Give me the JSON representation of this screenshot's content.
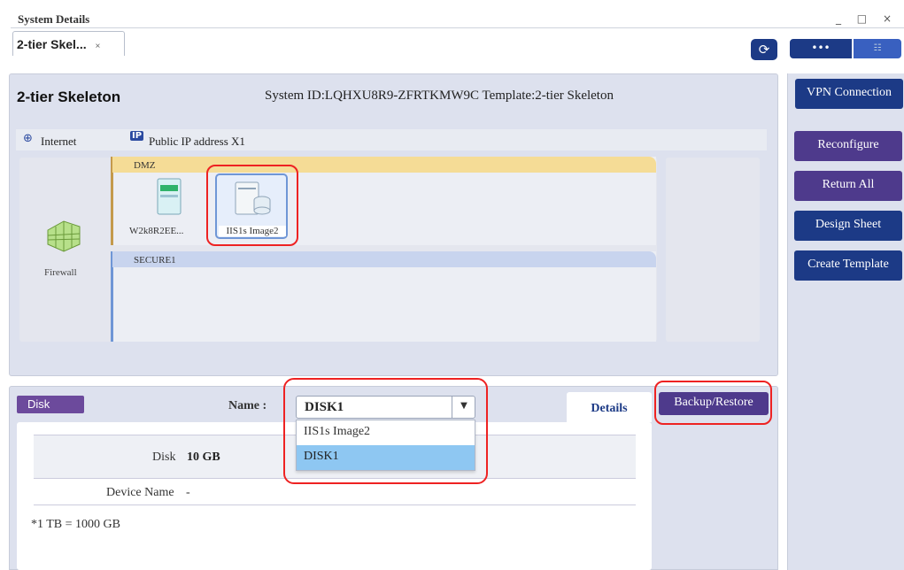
{
  "window": {
    "title": "System Details",
    "controls": {
      "minimize": "_",
      "maximize": "□",
      "close": "×"
    }
  },
  "tab": {
    "label": "2-tier Skel...",
    "close": "×"
  },
  "toolbar": {
    "refresh_icon": "⟳",
    "view_toggle": {
      "list_glyph": "•••",
      "grid_glyph": "☷"
    }
  },
  "system": {
    "name": "2-tier Skeleton",
    "info": "System ID:LQHXU8R9-ZFRTKMW9C  Template:2-tier Skeleton"
  },
  "network": {
    "internet_icon": "⊕",
    "internet_label": "Internet",
    "public_ip_icon": "IP",
    "public_ip_label": "Public IP address X1"
  },
  "diagram": {
    "firewall_label": "Firewall",
    "zones": [
      {
        "label": "DMZ",
        "color": "#f5dc96"
      },
      {
        "label": "SECURE1",
        "color": "#c8d4ee"
      }
    ],
    "servers": [
      {
        "label": "W2k8R2EE..."
      },
      {
        "label": "IIS1s Image2",
        "selected": true
      }
    ]
  },
  "side_buttons": {
    "vpn": "VPN Connection",
    "reconfigure": "Reconfigure",
    "return_all": "Return All",
    "design_sheet": "Design Sheet",
    "create_template": "Create Template"
  },
  "bottom": {
    "type_tag": "Disk",
    "name_label": "Name :",
    "name_value": "DISK1",
    "name_arrow": "▼",
    "dropdown_options": [
      "IIS1s Image2",
      "DISK1"
    ],
    "details_tab": "Details",
    "backup_button": "Backup/Restore",
    "rows": {
      "disk_key": "Disk",
      "disk_value": "10 GB",
      "device_key": "Device Name",
      "device_value": "-"
    },
    "note": "*1 TB = 1000 GB"
  },
  "colors": {
    "navy": "#1c3a86",
    "purple": "#4e3a8c",
    "highlight": "#e22222",
    "selected_option": "#8ec7f2"
  }
}
